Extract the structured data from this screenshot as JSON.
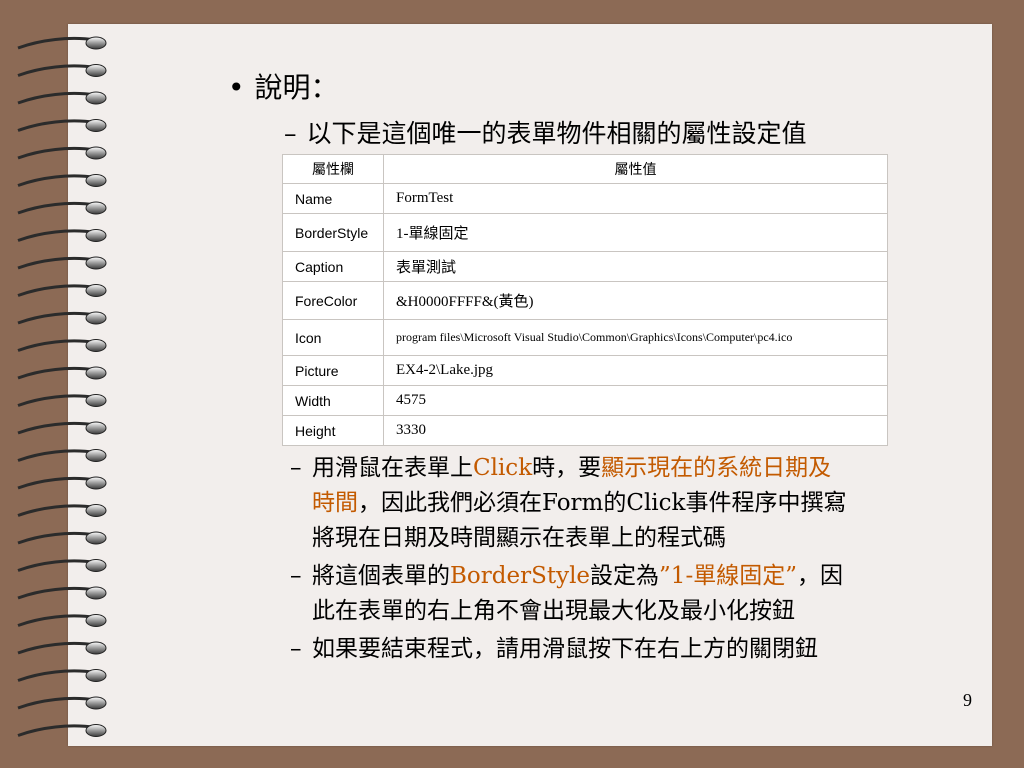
{
  "slide": {
    "heading": "說明：",
    "subheading": "以下是這個唯一的表單物件相關的屬性設定值",
    "page_number": "9"
  },
  "table": {
    "headers": [
      "屬性欄",
      "屬性值"
    ],
    "rows": [
      {
        "key": "Name",
        "value": "FormTest"
      },
      {
        "key": "BorderStyle",
        "value": "1-單線固定"
      },
      {
        "key": "Caption",
        "value": "表單測試"
      },
      {
        "key": "ForeColor",
        "value": "&H0000FFFF&(黃色)"
      },
      {
        "key": "Icon",
        "value": "program files\\Microsoft Visual Studio\\Common\\Graphics\\Icons\\Computer\\pc4.ico"
      },
      {
        "key": "Picture",
        "value": "EX4-2\\Lake.jpg"
      },
      {
        "key": "Width",
        "value": "4575"
      },
      {
        "key": "Height",
        "value": "3330"
      }
    ]
  },
  "notes": {
    "p1": {
      "a": "用滑鼠在表單上",
      "b": "Click",
      "c": "時，要",
      "d": "顯示現在的系統日期及",
      "e": "時間",
      "f": "，因此我們必須在Form的Click事件程序中撰寫",
      "g": "將現在日期及時間顯示在表單上的程式碼"
    },
    "p2": {
      "a": "將這個表單的",
      "b": "BorderStyle",
      "c": "設定為",
      "d": "”1-單線固定”",
      "e": "，因",
      "f": "此在表單的右上角不會出現最大化及最小化按鈕"
    },
    "p3": {
      "a": "如果要結束程式，請用滑鼠按下在右上方的關閉鈕"
    }
  },
  "colors": {
    "background": "#8c6a55",
    "paper": "#f2eeec",
    "highlight": "#c35a00"
  }
}
